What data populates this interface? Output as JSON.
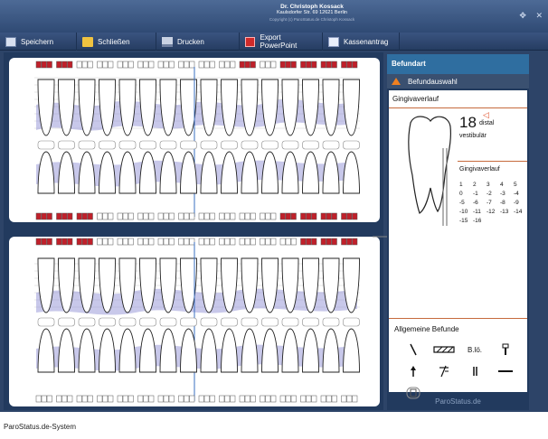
{
  "window": {
    "title_line1": "Dr. Christoph Kossack",
    "title_line2": "Kaulsdorfer Str. 69 12621 Berlin",
    "title_line3": "Copyright (c) ParoStatus.de Christoph Kossack"
  },
  "toolbar": {
    "save_label": "Speichern",
    "close_label": "Schließen",
    "print_label": "Drucken",
    "export_label": "Export PowerPoint",
    "kasse_label": "Kassenantrag"
  },
  "sidebar": {
    "header": "Befundart",
    "subheader": "Befundauswahl",
    "section_title": "Gingivaverlauf",
    "tooth_number": "18",
    "distal_label": "distal",
    "vestibular_label": "vestibulär",
    "gv_title": "Gingivaverlauf",
    "gv_values": [
      "1",
      "2",
      "3",
      "4",
      "5",
      "0",
      "-1",
      "-2",
      "-3",
      "-4",
      "-5",
      "-6",
      "-7",
      "-8",
      "-9",
      "-10",
      "-11",
      "-12",
      "-13",
      "-14",
      "-15",
      "-16"
    ],
    "general_title": "Allgemeine Befunde",
    "bloe_label": "B.lö.",
    "footer": "ParoStatus.de"
  },
  "caption": "ParoStatus.de-System",
  "colors": {
    "frame": "#2d4468",
    "accent_red": "#c0202a",
    "gum_band": "#9a9ad8",
    "sidebar_header": "#2f6ea0"
  }
}
